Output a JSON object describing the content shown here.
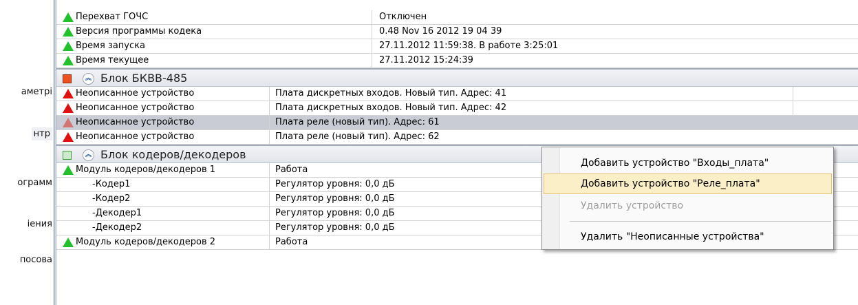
{
  "sidebar": {
    "items": [
      {
        "label": "аметрі"
      },
      {
        "label": "нтр"
      },
      {
        "label": "ограмм"
      },
      {
        "label": "іения"
      },
      {
        "label": "посова"
      }
    ]
  },
  "table": {
    "top_rows": [
      {
        "status": "green",
        "name": "Перехват ГОЧС",
        "value": "Отключен"
      },
      {
        "status": "green",
        "name": "Версия программы кодека",
        "value": "0.48 Nov 16 2012 19 04 39"
      },
      {
        "status": "green",
        "name": "Время запуска",
        "value": "27.11.2012  11:59:38.  В работе 3:25:01"
      },
      {
        "status": "green",
        "name": "Время текущее",
        "value": "27.11.2012  15:24:39"
      }
    ],
    "group1": {
      "title": "Блок БКВВ-485",
      "marker_color": "#f05020",
      "collapse_icon": "double-chevron-up-icon",
      "rows": [
        {
          "status": "red",
          "name": "Неописанное устройство",
          "value": "Плата дискретных входов. Новый тип. Адрес: 41"
        },
        {
          "status": "red",
          "name": "Неописанное устройство",
          "value": "Плата дискретных входов. Новый тип. Адрес: 42"
        },
        {
          "status": "pink",
          "name": "Неописанное устройство",
          "value": "Плата реле (новый тип). Адрес: 61",
          "selected": true
        },
        {
          "status": "red",
          "name": "Неописанное устройство",
          "value": "Плата реле (новый тип). Адрес: 62"
        }
      ]
    },
    "group2": {
      "title": "Блок кодеров/декодеров",
      "marker_color": "#cfe9cf",
      "collapse_icon": "double-chevron-up-icon",
      "rows": [
        {
          "status": "green",
          "name": "Модуль кодеров/декодеров 1",
          "value": "Работа"
        },
        {
          "status": "",
          "name": "-Кодер1",
          "value": "Регулятор уровня: 0,0 дБ"
        },
        {
          "status": "",
          "name": "-Кодер2",
          "value": "Регулятор уровня: 0,0 дБ"
        },
        {
          "status": "",
          "name": "-Декодер1",
          "value": "Регулятор уровня: 0,0 дБ"
        },
        {
          "status": "",
          "name": "-Декодер2",
          "value": "Регулятор уровня: 0,0 дБ"
        },
        {
          "status": "green",
          "name": "Модуль кодеров/декодеров 2",
          "value": "Работа"
        }
      ]
    }
  },
  "context_menu": {
    "items": [
      {
        "label": "Добавить устройство \"Входы_плата\"",
        "state": "normal"
      },
      {
        "label": "Добавить устройство \"Реле_плата\"",
        "state": "hover"
      },
      {
        "label": "Удалить устройство",
        "state": "disabled"
      },
      {
        "label": "Удалить \"Неописанные устройства\"",
        "state": "normal"
      }
    ]
  },
  "colors": {
    "status_ok": "#22c02a",
    "status_error": "#e01010",
    "status_error_selected": "#d07474",
    "menu_hover": "#fbefc8"
  }
}
